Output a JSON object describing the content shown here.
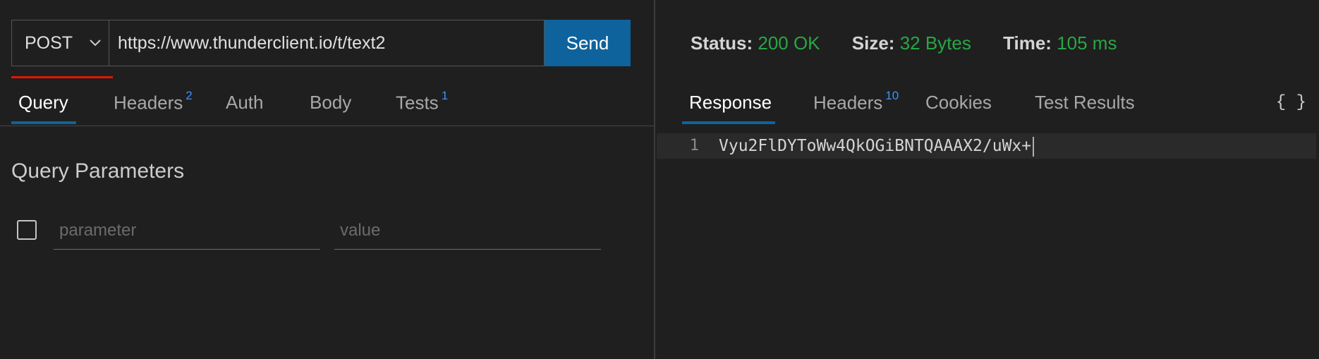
{
  "request": {
    "method": "POST",
    "url": "https://www.thunderclient.io/t/text2",
    "send_label": "Send"
  },
  "request_tabs": [
    {
      "label": "Query",
      "badge": ""
    },
    {
      "label": "Headers",
      "badge": "2"
    },
    {
      "label": "Auth",
      "badge": ""
    },
    {
      "label": "Body",
      "badge": ""
    },
    {
      "label": "Tests",
      "badge": "1"
    }
  ],
  "query": {
    "title": "Query Parameters",
    "param_placeholder": "parameter",
    "value_placeholder": "value"
  },
  "response_status": {
    "status_label": "Status:",
    "status_value": "200 OK",
    "size_label": "Size:",
    "size_value": "32 Bytes",
    "time_label": "Time:",
    "time_value": "105 ms"
  },
  "response_tabs": [
    {
      "label": "Response",
      "badge": ""
    },
    {
      "label": "Headers",
      "badge": "10"
    },
    {
      "label": "Cookies",
      "badge": ""
    },
    {
      "label": "Test Results",
      "badge": ""
    }
  ],
  "format_label": "{ }",
  "response_body": {
    "line_number": "1",
    "content": "Vyu2FlDYToWw4QkOGiBNTQAAAX2/uWx+"
  },
  "colors": {
    "accent": "#0e639c",
    "success": "#28a745",
    "badge": "#3794ff",
    "method_indicator": "#e51400",
    "background": "#1f1f1f"
  }
}
